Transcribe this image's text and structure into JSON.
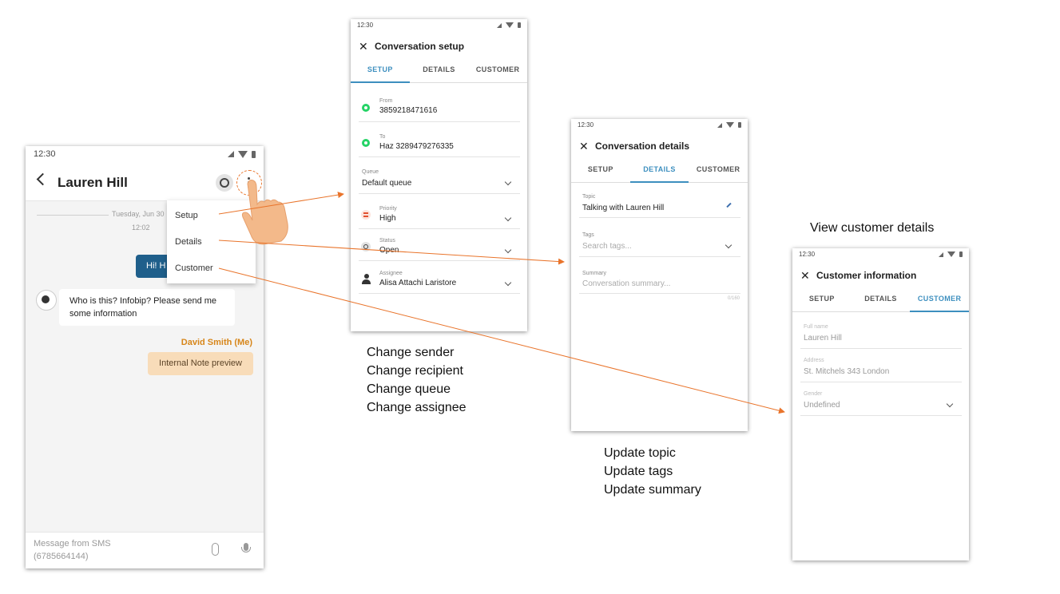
{
  "chat": {
    "status_time": "12:30",
    "contact_name": "Lauren Hill",
    "date_label": "Tuesday, Jun 30",
    "time_label": "12:02",
    "outgoing_bubble": "Hi! H",
    "incoming_message": "Who is this? Infobip? Please send me some information",
    "agent_name": "David Smith (Me)",
    "internal_note": "Internal Note preview",
    "composer_placeholder": "Message from SMS (6785664144)",
    "menu": [
      "Setup",
      "Details",
      "Customer"
    ]
  },
  "setup": {
    "status_time": "12:30",
    "title": "Conversation setup",
    "tabs": [
      "SETUP",
      "DETAILS",
      "CUSTOMER"
    ],
    "active_tab": "SETUP",
    "fields": {
      "from_label": "From",
      "from_value": "3859218471616",
      "to_label": "To",
      "to_value": "Haz 3289479276335",
      "queue_label": "Queue",
      "queue_value": "Default queue",
      "priority_label": "Priority",
      "priority_value": "High",
      "status_label": "Status",
      "status_value": "Open",
      "assignee_label": "Assignee",
      "assignee_value": "Alisa Attachi Laristore"
    }
  },
  "details": {
    "status_time": "12:30",
    "title": "Conversation details",
    "tabs": [
      "SETUP",
      "DETAILS",
      "CUSTOMER"
    ],
    "active_tab": "DETAILS",
    "fields": {
      "topic_label": "Topic",
      "topic_value": "Talking with Lauren Hill",
      "tags_label": "Tags",
      "tags_placeholder": "Search tags...",
      "summary_label": "Summary",
      "summary_placeholder": "Conversation summary...",
      "summary_counter": "0/160"
    }
  },
  "customer": {
    "status_time": "12:30",
    "title": "Customer information",
    "tabs": [
      "SETUP",
      "DETAILS",
      "CUSTOMER"
    ],
    "active_tab": "CUSTOMER",
    "fields": {
      "fullname_label": "Full name",
      "fullname_value": "Lauren Hill",
      "address_label": "Address",
      "address_value": "St. Mitchels 343 London",
      "gender_label": "Gender",
      "gender_value": "Undefined"
    }
  },
  "captions": {
    "setup": [
      "Change sender",
      "Change recipient",
      "Change queue",
      "Change assignee"
    ],
    "details": [
      "Update topic",
      "Update tags",
      "Update summary"
    ],
    "customer_heading": "View customer details"
  },
  "colors": {
    "accent_blue": "#3d8fbf",
    "bubble_blue": "#1f5f8b",
    "arrow_orange": "#e9742b",
    "agent_orange": "#d7861a",
    "note_bg": "#f8dcb9",
    "whatsapp_green": "#25d366"
  },
  "icons": [
    "close-icon",
    "back-arrow-icon",
    "more-vert-icon",
    "whatsapp-icon",
    "chevron-down-icon",
    "pencil-icon",
    "paperclip-icon",
    "microphone-icon",
    "hand-pointer-icon"
  ]
}
